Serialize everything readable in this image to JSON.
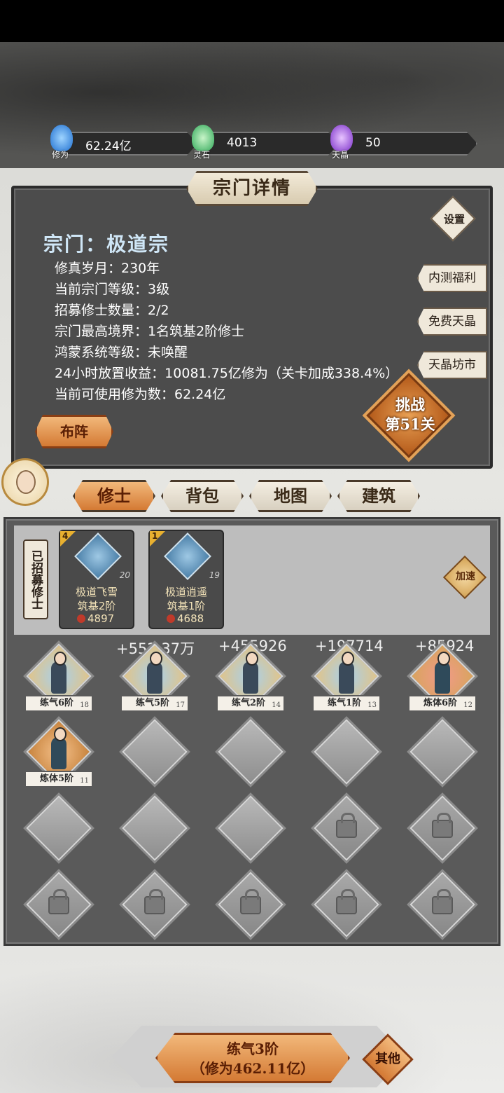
{
  "resources": [
    {
      "value": "62.24亿",
      "caption": "修为",
      "icon": "blue-flame-icon",
      "color": "#2f8fe8"
    },
    {
      "value": "4013",
      "caption": "灵石",
      "icon": "green-crystal-icon",
      "color": "#3fbf6a"
    },
    {
      "value": "50",
      "caption": "天晶",
      "icon": "purple-crystal-icon",
      "color": "#9a4fe0"
    }
  ],
  "panel": {
    "title": "宗门详情",
    "sect_name": "宗门：极道宗",
    "info": [
      "修真岁月：230年",
      "当前宗门等级：3级",
      "招募修士数量：2/2",
      "宗门最高境界：1名筑基2阶修士",
      "鸿蒙系统等级：未唤醒",
      "24小时放置收益：10081.75亿修为（关卡加成338.4%）",
      "当前可使用修为数：62.24亿"
    ],
    "settings_label": "设置",
    "side_buttons": [
      "内测福利",
      "免费天晶",
      "天晶坊市"
    ],
    "challenge_label_1": "挑战",
    "challenge_label_2": "第51关",
    "formation_label": "布阵"
  },
  "tabs": [
    {
      "label": "修士",
      "active": true
    },
    {
      "label": "背包",
      "active": false
    },
    {
      "label": "地图",
      "active": false
    },
    {
      "label": "建筑",
      "active": false
    }
  ],
  "recruit": {
    "tag": "已招募修士",
    "speed_label": "加速",
    "cards": [
      {
        "badge": "4",
        "level": "20",
        "name": "极道飞雪",
        "realm": "筑基2阶",
        "power": "4897"
      },
      {
        "badge": "1",
        "level": "19",
        "name": "极道逍遥",
        "realm": "筑基1阶",
        "power": "4688"
      }
    ]
  },
  "gains": [
    "+552.37万",
    "+455926",
    "+197714",
    "+85924"
  ],
  "slots": [
    {
      "rank": "练气6阶",
      "level": "18",
      "style": "blue"
    },
    {
      "rank": "练气5阶",
      "level": "17",
      "style": "blue"
    },
    {
      "rank": "练气2阶",
      "level": "14",
      "style": "blue"
    },
    {
      "rank": "练气1阶",
      "level": "13",
      "style": "blue"
    },
    {
      "rank": "炼体6阶",
      "level": "12",
      "style": "red"
    },
    {
      "rank": "炼体5阶",
      "level": "11",
      "style": "orange"
    }
  ],
  "bottom": {
    "main_line1": "练气3阶",
    "main_line2": "（修为462.11亿）",
    "other_label": "其他"
  }
}
